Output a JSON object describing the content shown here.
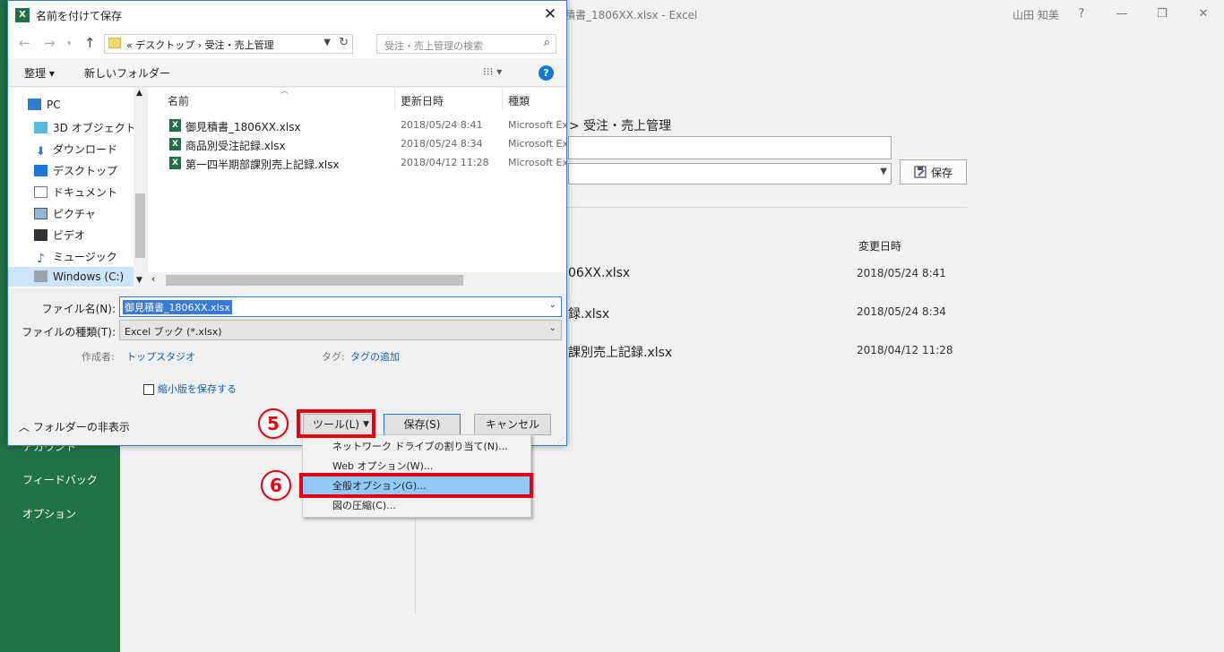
{
  "background": {
    "title": "積書_1806XX.xlsx  -  Excel",
    "user": "山田 知美",
    "window_controls": [
      "?",
      "—",
      "❐",
      "✕"
    ],
    "sidebar_items": [
      "アカウント",
      "フィードバック",
      "オプション"
    ],
    "breadcrumb": "> 受注・売上管理",
    "save_button": "保存",
    "column_header_date": "変更日時",
    "files": [
      {
        "name": "06XX.xlsx",
        "date": "2018/05/24 8:41"
      },
      {
        "name": "録.xlsx",
        "date": "2018/05/24 8:34"
      },
      {
        "name": "課別売上記録.xlsx",
        "date": "2018/04/12 11:28"
      }
    ]
  },
  "dialog": {
    "title": "名前を付けて保存",
    "address": "« デスクトップ  ›  受注・売上管理",
    "search_placeholder": "受注・売上管理の検索",
    "toolbar": {
      "organize": "整理 ▾",
      "new_folder": "新しいフォルダー",
      "view": "⁝⁝⁝ ▾",
      "help": "?"
    },
    "nav_items": [
      "PC",
      "3D オブジェクト",
      "ダウンロード",
      "デスクトップ",
      "ドキュメント",
      "ピクチャ",
      "ビデオ",
      "ミュージック",
      "Windows (C:)"
    ],
    "columns": {
      "name": "名前",
      "date": "更新日時",
      "type": "種類"
    },
    "files": [
      {
        "name": "御見積書_1806XX.xlsx",
        "date": "2018/05/24 8:41",
        "type": "Microsoft Excel"
      },
      {
        "name": "商品別受注記録.xlsx",
        "date": "2018/05/24 8:34",
        "type": "Microsoft Excel"
      },
      {
        "name": "第一四半期部課別売上記録.xlsx",
        "date": "2018/04/12 11:28",
        "type": "Microsoft Excel"
      }
    ],
    "filename_label": "ファイル名(N):",
    "filename_value": "御見積書_1806XX.xlsx",
    "filetype_label": "ファイルの種類(T):",
    "filetype_value": "Excel ブック (*.xlsx)",
    "author_label": "作成者:",
    "author_value": "トップスタジオ",
    "tags_label": "タグ:",
    "tags_value": "タグの追加",
    "thumbnail_label": "縮小版を保存する",
    "hide_folders": "フォルダーの非表示",
    "tools_button": "ツール(L)",
    "save_button": "保存(S)",
    "cancel_button": "キャンセル"
  },
  "tools_menu": [
    "ネットワーク ドライブの割り当て(N)...",
    "Web オプション(W)...",
    "全般オプション(G)...",
    "図の圧縮(C)..."
  ],
  "callouts": {
    "step5": "5",
    "step6": "6",
    "color": "#e60012"
  }
}
